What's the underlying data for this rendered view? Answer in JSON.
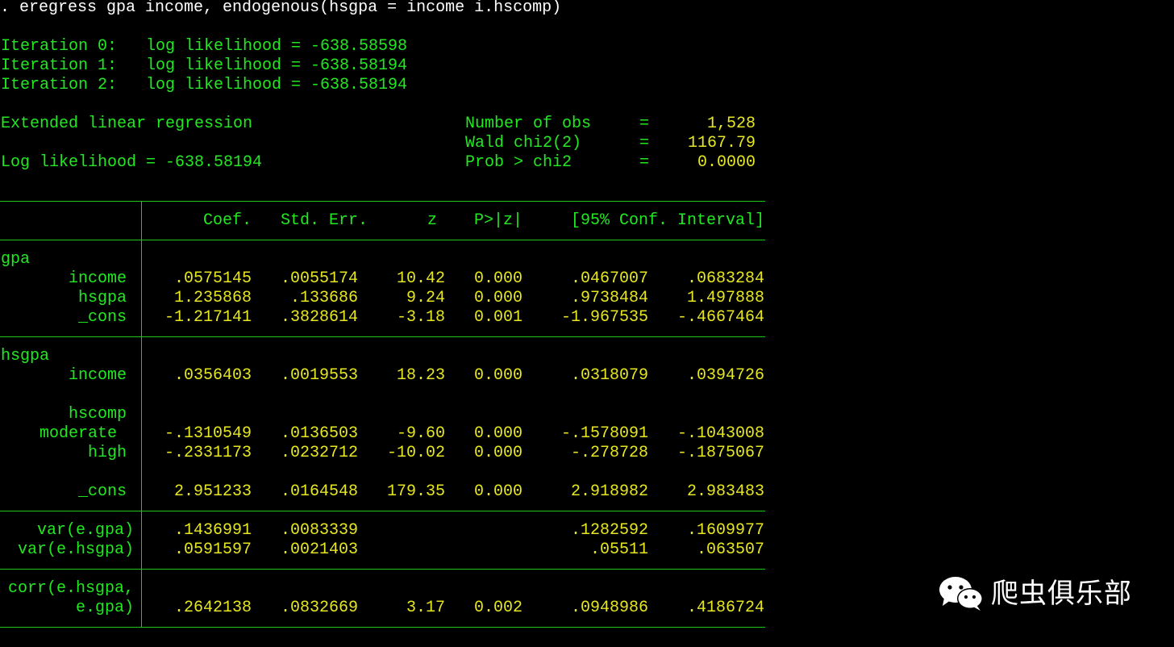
{
  "command": ". eregress gpa income, endogenous(hsgpa = income i.hscomp)",
  "iterations": [
    {
      "label": "Iteration 0:",
      "text": "log likelihood = -638.58598"
    },
    {
      "label": "Iteration 1:",
      "text": "log likelihood = -638.58194"
    },
    {
      "label": "Iteration 2:",
      "text": "log likelihood = -638.58194"
    }
  ],
  "model_title": "Extended linear regression",
  "log_likelihood": "Log likelihood = -638.58194",
  "stats": [
    {
      "label": "Number of obs",
      "eq": "=",
      "value": "1,528"
    },
    {
      "label": "Wald chi2(2)",
      "eq": "=",
      "value": "1167.79"
    },
    {
      "label": "Prob > chi2",
      "eq": "=",
      "value": "0.0000"
    }
  ],
  "headers": {
    "coef": "Coef.",
    "se": "Std. Err.",
    "z": "z",
    "p": "P>|z|",
    "ci": "[95% Conf. Interval]"
  },
  "rows": [
    {
      "label": "gpa",
      "kind": "eq"
    },
    {
      "label": "income",
      "coef": ".0575145",
      "se": ".0055174",
      "z": "10.42",
      "p": "0.000",
      "lo": ".0467007",
      "hi": ".0683284"
    },
    {
      "label": "hsgpa",
      "coef": "1.235868",
      "se": ".133686",
      "z": "9.24",
      "p": "0.000",
      "lo": ".9738484",
      "hi": "1.497888"
    },
    {
      "label": "_cons",
      "coef": "-1.217141",
      "se": ".3828614",
      "z": "-3.18",
      "p": "0.001",
      "lo": "-1.967535",
      "hi": "-.4667464"
    },
    {
      "label": "hsgpa",
      "kind": "eq"
    },
    {
      "label": "income",
      "coef": ".0356403",
      "se": ".0019553",
      "z": "18.23",
      "p": "0.000",
      "lo": ".0318079",
      "hi": ".0394726"
    },
    {
      "label": "hscomp",
      "kind": "group"
    },
    {
      "label": "moderate",
      "coef": "-.1310549",
      "se": ".0136503",
      "z": "-9.60",
      "p": "0.000",
      "lo": "-.1578091",
      "hi": "-.1043008"
    },
    {
      "label": "high",
      "coef": "-.2331173",
      "se": ".0232712",
      "z": "-10.02",
      "p": "0.000",
      "lo": "-.278728",
      "hi": "-.1875067"
    },
    {
      "label": "_cons",
      "coef": "2.951233",
      "se": ".0164548",
      "z": "179.35",
      "p": "0.000",
      "lo": "2.918982",
      "hi": "2.983483"
    },
    {
      "label": "var(e.gpa)",
      "coef": ".1436991",
      "se": ".0083339",
      "z": "",
      "p": "",
      "lo": ".1282592",
      "hi": ".1609977"
    },
    {
      "label": "var(e.hsgpa)",
      "coef": ".0591597",
      "se": ".0021403",
      "z": "",
      "p": "",
      "lo": ".05511",
      "hi": ".063507"
    },
    {
      "label": "corr(e.hsgpa,",
      "kind": "label-only"
    },
    {
      "label": "e.gpa)",
      "coef": ".2642138",
      "se": ".0832669",
      "z": "3.17",
      "p": "0.002",
      "lo": ".0948986",
      "hi": ".4186724"
    }
  ],
  "watermark": {
    "text": "爬虫俱乐部",
    "icon": "wechat-icon"
  },
  "colors": {
    "background": "#000000",
    "command": "#ffffff",
    "label": "#22e822",
    "value": "#e6e622",
    "rule": "#22c422"
  }
}
